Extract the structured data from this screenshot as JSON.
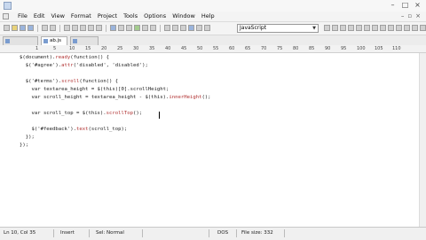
{
  "window": {
    "title": ""
  },
  "menu": [
    "File",
    "Edit",
    "View",
    "Format",
    "Project",
    "Tools",
    "Options",
    "Window",
    "Help"
  ],
  "toolbar": {
    "language": "JavaScript"
  },
  "tabs": [
    "",
    "ab.js",
    ""
  ],
  "ruler": [
    "1",
    "5",
    "10",
    "15",
    "20",
    "25",
    "30",
    "35",
    "40",
    "45",
    "50",
    "55",
    "60",
    "65",
    "70",
    "75",
    "80",
    "85",
    "90",
    "95",
    "100",
    "105",
    "110"
  ],
  "code": [
    "$(document).ready(function() {",
    "  $('#agree').attr('disabled', 'disabled');",
    "",
    "  $('#terms').scroll(function() {",
    "    var textarea_height = $(this)[0].scrollHeight;",
    "    var scroll_height = textarea_height - $(this).innerHeight();",
    "",
    "    var scroll_top = $(this).scrollTop();",
    "",
    "    $('#feedback').text(scroll_top);",
    "  });",
    "});"
  ],
  "status": {
    "position": "Ln 10, Col 35",
    "insert": "Insert",
    "encoding": "Sel: Normal",
    "line_ending": "DOS",
    "file_size": "File size: 332"
  }
}
